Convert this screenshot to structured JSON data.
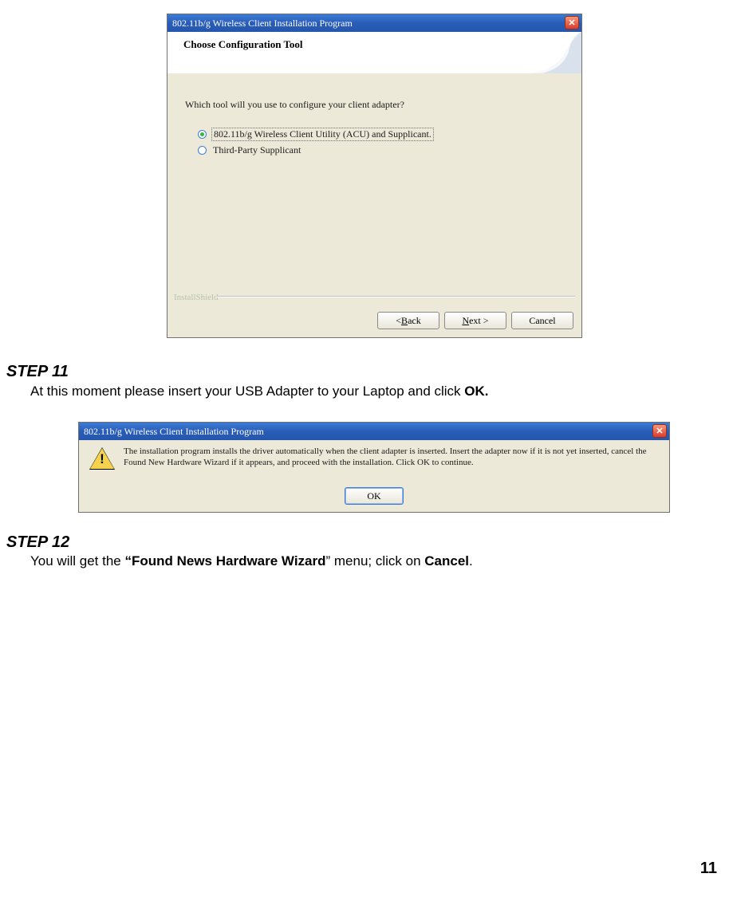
{
  "page_number": "11",
  "step11": {
    "heading": "STEP 11",
    "body_pre": "At this moment please insert your USB Adapter to your Laptop and click ",
    "body_bold": "OK.",
    "body_post": ""
  },
  "step12": {
    "heading": "STEP 12",
    "p1": "You will get the ",
    "p2_bold": "“Found News Hardware Wizard",
    "p3": "” menu; click on ",
    "p4_bold": "Cancel",
    "p5": "."
  },
  "dialog1": {
    "title": "802.11b/g  Wireless Client Installation Program",
    "banner": "Choose Configuration Tool",
    "prompt": "Which tool will you use to configure your client adapter?",
    "option1": "802.11b/g Wireless Client Utility (ACU) and Supplicant.",
    "option2": "Third-Party Supplicant",
    "installshield": "InstallShield",
    "back_lt": "< ",
    "back_u": "B",
    "back_rest": "ack",
    "next_u": "N",
    "next_rest": "ext >",
    "cancel": "Cancel"
  },
  "dialog2": {
    "title": "802.11b/g  Wireless Client Installation Program",
    "message": "The installation program installs the driver automatically when the client adapter is inserted. Insert the adapter now if it is not yet inserted, cancel the Found New Hardware Wizard if it appears, and proceed with the installation. Click OK to continue.",
    "ok": "OK"
  }
}
